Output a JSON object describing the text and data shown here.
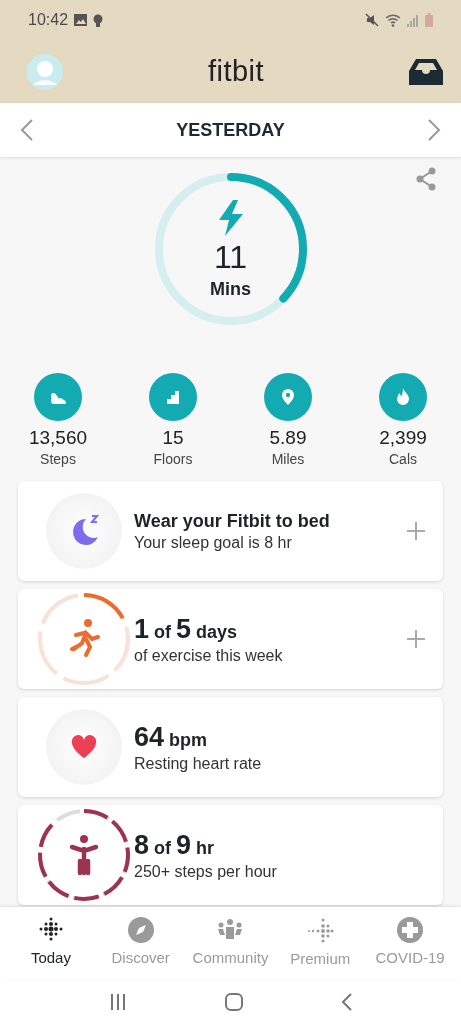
{
  "status_bar": {
    "time": "10:42"
  },
  "header": {
    "title": "fitbit"
  },
  "date_nav": {
    "label": "YESTERDAY"
  },
  "zone_minutes": {
    "value": "11",
    "unit": "Mins"
  },
  "stats": [
    {
      "kind": "steps",
      "value": "13,560",
      "label": "Steps"
    },
    {
      "kind": "floors",
      "value": "15",
      "label": "Floors"
    },
    {
      "kind": "distance",
      "value": "5.89",
      "label": "Miles"
    },
    {
      "kind": "calories",
      "value": "2,399",
      "label": "Cals"
    }
  ],
  "cards": [
    {
      "kind": "sleep",
      "title": "Wear your Fitbit to bed",
      "subtitle": "Your sleep goal is 8 hr",
      "addable": true
    },
    {
      "kind": "exercise",
      "title": "**1** of **5** days",
      "subtitle": "of exercise this week",
      "addable": true
    },
    {
      "kind": "heart",
      "title": "**64** bpm",
      "subtitle": "Resting heart rate",
      "addable": false
    },
    {
      "kind": "hourly",
      "title": "**8** of **9** hr",
      "subtitle": "250+ steps per hour",
      "addable": false
    }
  ],
  "tabs": [
    {
      "kind": "today",
      "label": "Today",
      "selected": true
    },
    {
      "kind": "discover",
      "label": "Discover",
      "selected": false
    },
    {
      "kind": "community",
      "label": "Community",
      "selected": false
    },
    {
      "kind": "premium",
      "label": "Premium",
      "selected": false
    },
    {
      "kind": "covid",
      "label": "COVID-19",
      "selected": false
    }
  ]
}
